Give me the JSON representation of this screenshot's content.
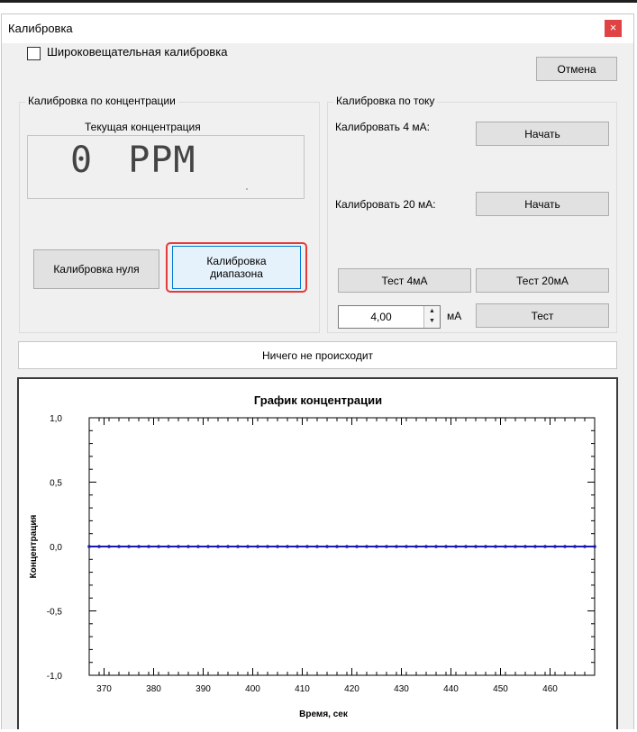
{
  "window": {
    "title": "Калибровка",
    "close_glyph": "×"
  },
  "broadcast": {
    "label": "Широковещательная калибровка",
    "checked": false
  },
  "cancel_label": "Отмена",
  "conc": {
    "group_title": "Калибровка по концентрации",
    "current_label": "Текущая концентрация",
    "value": "0",
    "unit": "PPM",
    "zero_label": "Калибровка нуля",
    "range_label_1": "Калибровка",
    "range_label_2": "диапазона"
  },
  "current": {
    "group_title": "Калибровка по току",
    "cal4_label": "Калибровать 4 мА:",
    "cal20_label": "Калибровать 20 мА:",
    "start_label": "Начать",
    "test4_label": "Тест 4мА",
    "test20_label": "Тест 20мА",
    "ma_value": "4,00",
    "ma_unit": "мА",
    "test_label": "Тест"
  },
  "status_text": "Ничего не происходит",
  "icons": {
    "checkbox": "checkbox-icon",
    "spinner": "spinner-arrows-icon",
    "close": "close-icon"
  },
  "colors": {
    "highlight": "#e23b3b",
    "series": "#1a1ab0",
    "close": "#e04343"
  },
  "chart_data": {
    "type": "line",
    "title": "График концентрации",
    "xlabel": "Время, сек",
    "ylabel": "Концентрация",
    "xlim": [
      367,
      469
    ],
    "ylim": [
      -1.0,
      1.0
    ],
    "x_ticks": [
      370,
      380,
      390,
      400,
      410,
      420,
      430,
      440,
      450,
      460
    ],
    "y_ticks": [
      "1,0",
      "0,5",
      "0,0",
      "-0,5",
      "-1,0"
    ],
    "series": [
      {
        "values_x": [
          367,
          369,
          371,
          373,
          375,
          377,
          379,
          381,
          383,
          385,
          387,
          389,
          391,
          393,
          395,
          397,
          399,
          401,
          403,
          405,
          407,
          409,
          411,
          413,
          415,
          417,
          419,
          421,
          423,
          425,
          427,
          429,
          431,
          433,
          435,
          437,
          439,
          441,
          443,
          445,
          447,
          449,
          451,
          453,
          455,
          457,
          459,
          461,
          463,
          465,
          467,
          469
        ],
        "values_y": [
          0,
          0,
          0,
          0,
          0,
          0,
          0,
          0,
          0,
          0,
          0,
          0,
          0,
          0,
          0,
          0,
          0,
          0,
          0,
          0,
          0,
          0,
          0,
          0,
          0,
          0,
          0,
          0,
          0,
          0,
          0,
          0,
          0,
          0,
          0,
          0,
          0,
          0,
          0,
          0,
          0,
          0,
          0,
          0,
          0,
          0,
          0,
          0,
          0,
          0,
          0,
          0
        ]
      }
    ],
    "grid": false,
    "legend": "none"
  }
}
